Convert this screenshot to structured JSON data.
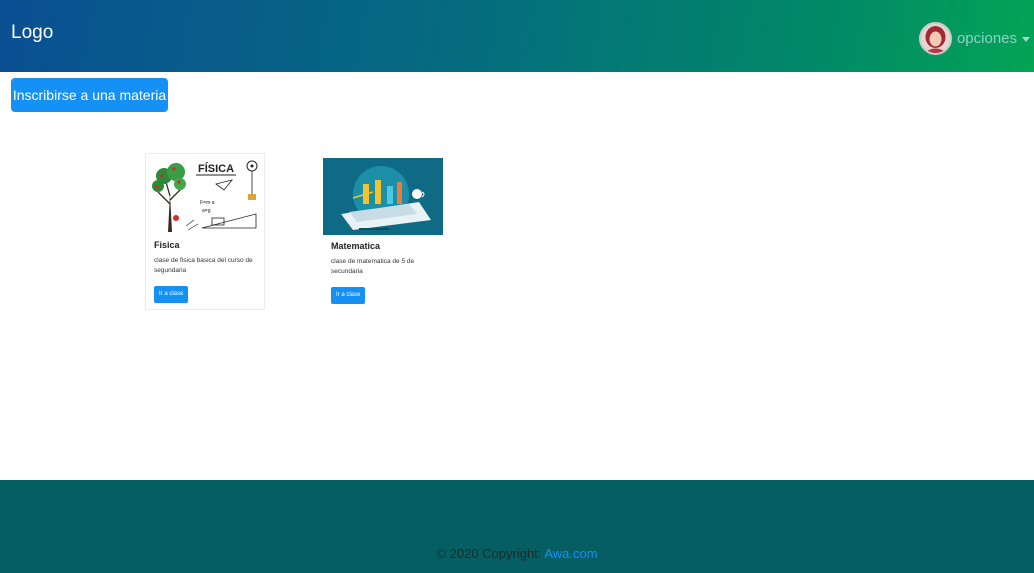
{
  "navbar": {
    "logo": "Logo",
    "user_menu_label": "opciones"
  },
  "main": {
    "enroll_button": "Inscribirse a una materia"
  },
  "courses": [
    {
      "title": "Fisica",
      "description": "clase de fisica basica del curso de segundaria",
      "button": "Ir a clase",
      "image_text": "FÍSICA"
    },
    {
      "title": "Matematica",
      "description": "clase de matematica de 5 de secundaria",
      "button": "Ir a clase"
    }
  ],
  "footer": {
    "copyright": "© 2020 Copyright: ",
    "link_text": "Awa.com"
  },
  "colors": {
    "primary": "#1590f5",
    "footer_bg": "#045e62",
    "navbar_start": "#0a4f93",
    "navbar_end": "#03a456"
  }
}
